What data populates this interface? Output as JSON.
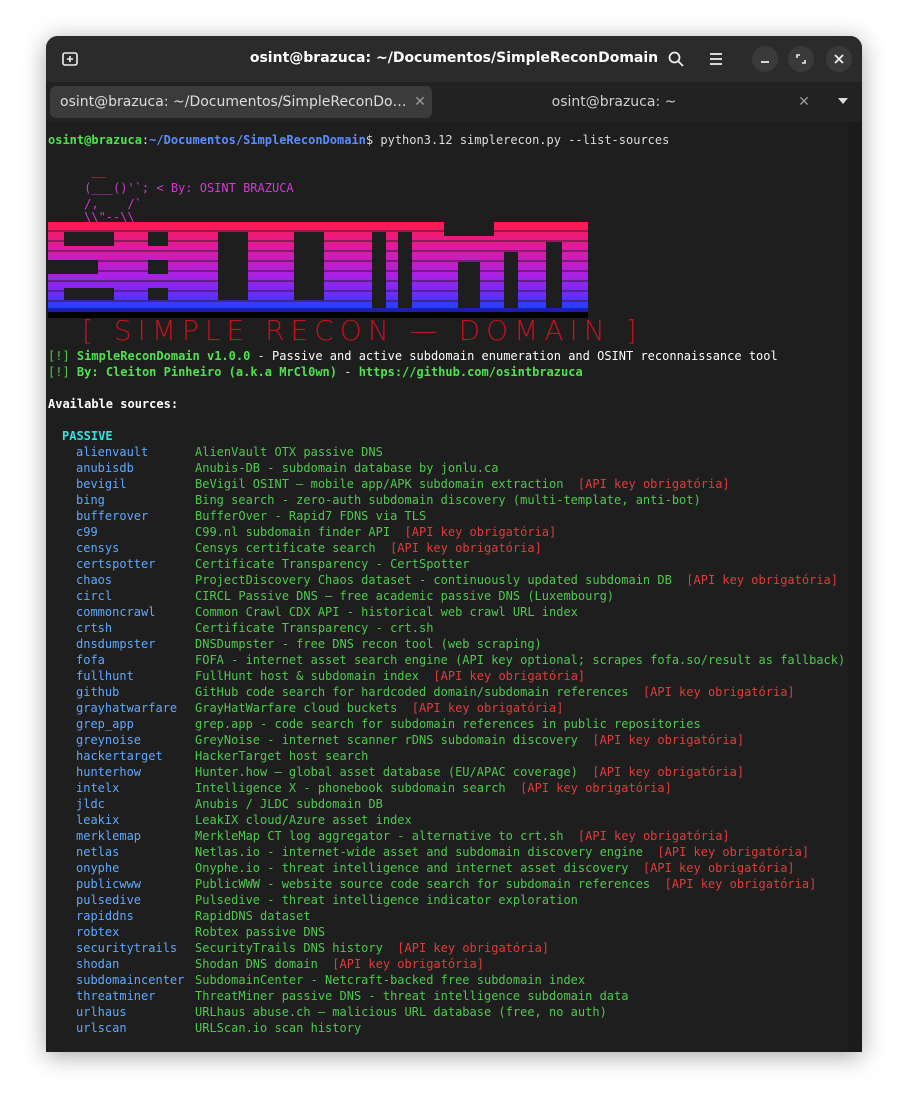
{
  "window": {
    "title": "osint@brazuca: ~/Documentos/SimpleReconDomain",
    "tabs": [
      {
        "label": "osint@brazuca: ~/Documentos/SimpleReconDo…",
        "close": "✕"
      },
      {
        "label": "osint@brazuca: ~",
        "close": "✕"
      }
    ]
  },
  "prompt": {
    "user": "osint@brazuca",
    "colon": ":",
    "path": "~/Documentos/SimpleReconDomain",
    "sign": "$",
    "command": " python3.12 simplerecon.py --list-sources"
  },
  "ascii": {
    "l1": "      __",
    "l2": "     (___()'`; < By: OSINT BRAZUCA",
    "l3": "     /,    /`",
    "l4": "     \\\\\"--\\\\"
  },
  "banner": {
    "subtitle": "[ SIMPLE RECON — DOMAIN ]"
  },
  "info": {
    "tag": "[!]",
    "name": "SimpleReconDomain v1.0.0",
    "dash": " - ",
    "tagline": "Passive and active subdomain enumeration and OSINT reconnaissance tool",
    "author": "By: Cleiton Pinheiro (a.k.a MrCl0wn)",
    "sep": " - ",
    "url": "https://github.com/osintbrazuca"
  },
  "available": "Available sources:",
  "section": "PASSIVE",
  "sources": [
    {
      "name": "alienvault",
      "desc": "AlienVault OTX passive DNS",
      "api": ""
    },
    {
      "name": "anubisdb",
      "desc": "Anubis-DB - subdomain database by jonlu.ca",
      "api": ""
    },
    {
      "name": "bevigil",
      "desc": "BeVigil OSINT — mobile app/APK subdomain extraction",
      "api": "[API key obrigatória]"
    },
    {
      "name": "bing",
      "desc": "Bing search - zero-auth subdomain discovery (multi-template, anti-bot)",
      "api": ""
    },
    {
      "name": "bufferover",
      "desc": "BufferOver - Rapid7 FDNS via TLS",
      "api": ""
    },
    {
      "name": "c99",
      "desc": "C99.nl subdomain finder API",
      "api": "[API key obrigatória]"
    },
    {
      "name": "censys",
      "desc": "Censys certificate search",
      "api": "[API key obrigatória]"
    },
    {
      "name": "certspotter",
      "desc": "Certificate Transparency - CertSpotter",
      "api": ""
    },
    {
      "name": "chaos",
      "desc": "ProjectDiscovery Chaos dataset - continuously updated subdomain DB",
      "api": "[API key obrigatória]"
    },
    {
      "name": "circl",
      "desc": "CIRCL Passive DNS — free academic passive DNS (Luxembourg)",
      "api": ""
    },
    {
      "name": "commoncrawl",
      "desc": "Common Crawl CDX API - historical web crawl URL index",
      "api": ""
    },
    {
      "name": "crtsh",
      "desc": "Certificate Transparency - crt.sh",
      "api": ""
    },
    {
      "name": "dnsdumpster",
      "desc": "DNSDumpster - free DNS recon tool (web scraping)",
      "api": ""
    },
    {
      "name": "fofa",
      "desc": "FOFA - internet asset search engine (API key optional; scrapes fofa.so/result as fallback)",
      "api": ""
    },
    {
      "name": "fullhunt",
      "desc": "FullHunt host & subdomain index",
      "api": "[API key obrigatória]"
    },
    {
      "name": "github",
      "desc": "GitHub code search for hardcoded domain/subdomain references",
      "api": "[API key obrigatória]"
    },
    {
      "name": "grayhatwarfare",
      "desc": "GrayHatWarfare cloud buckets",
      "api": "[API key obrigatória]"
    },
    {
      "name": "grep_app",
      "desc": "grep.app - code search for subdomain references in public repositories",
      "api": ""
    },
    {
      "name": "greynoise",
      "desc": "GreyNoise - internet scanner rDNS subdomain discovery",
      "api": "[API key obrigatória]"
    },
    {
      "name": "hackertarget",
      "desc": "HackerTarget host search",
      "api": ""
    },
    {
      "name": "hunterhow",
      "desc": "Hunter.how — global asset database (EU/APAC coverage)",
      "api": "[API key obrigatória]"
    },
    {
      "name": "intelx",
      "desc": "Intelligence X - phonebook subdomain search",
      "api": "[API key obrigatória]"
    },
    {
      "name": "jldc",
      "desc": "Anubis / JLDC subdomain DB",
      "api": ""
    },
    {
      "name": "leakix",
      "desc": "LeakIX cloud/Azure asset index",
      "api": ""
    },
    {
      "name": "merklemap",
      "desc": "MerkleMap CT log aggregator - alternative to crt.sh",
      "api": "[API key obrigatória]"
    },
    {
      "name": "netlas",
      "desc": "Netlas.io - internet-wide asset and subdomain discovery engine",
      "api": "[API key obrigatória]"
    },
    {
      "name": "onyphe",
      "desc": "Onyphe.io - threat intelligence and internet asset discovery",
      "api": "[API key obrigatória]"
    },
    {
      "name": "publicwww",
      "desc": "PublicWWW - website source code search for subdomain references",
      "api": "[API key obrigatória]"
    },
    {
      "name": "pulsedive",
      "desc": "Pulsedive - threat intelligence indicator exploration",
      "api": ""
    },
    {
      "name": "rapiddns",
      "desc": "RapidDNS dataset",
      "api": ""
    },
    {
      "name": "robtex",
      "desc": "Robtex passive DNS",
      "api": ""
    },
    {
      "name": "securitytrails",
      "desc": "SecurityTrails DNS history",
      "api": "[API key obrigatória]"
    },
    {
      "name": "shodan",
      "desc": "Shodan DNS domain",
      "api": "[API key obrigatória]"
    },
    {
      "name": "subdomaincenter",
      "desc": "SubdomainCenter - Netcraft-backed free subdomain index",
      "api": ""
    },
    {
      "name": "threatminer",
      "desc": "ThreatMiner passive DNS - threat intelligence subdomain data",
      "api": ""
    },
    {
      "name": "urlhaus",
      "desc": "URLhaus abuse.ch — malicious URL database (free, no auth)",
      "api": ""
    },
    {
      "name": "urlscan",
      "desc": "URLScan.io scan history",
      "api": ""
    }
  ]
}
